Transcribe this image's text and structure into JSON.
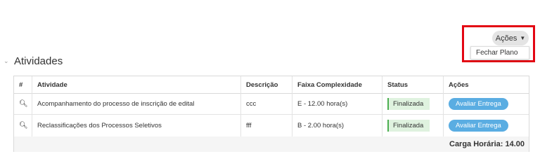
{
  "toolbar": {
    "acoes_label": "Ações",
    "dropdown_item": "Fechar Plano"
  },
  "section": {
    "title": "Atividades"
  },
  "table": {
    "headers": [
      "#",
      "Atividade",
      "Descrição",
      "Faixa Complexidade",
      "Status",
      "Ações"
    ],
    "rows": [
      {
        "atividade": "Acompanhamento do processo de inscrição de edital",
        "descricao": "ccc",
        "faixa": "E - 12.00 hora(s)",
        "status": "Finalizada",
        "acao": "Avaliar Entrega"
      },
      {
        "atividade": "Reclassificações dos Processos Seletivos",
        "descricao": "fff",
        "faixa": "B - 2.00 hora(s)",
        "status": "Finalizada",
        "acao": "Avaliar Entrega"
      }
    ],
    "footer": "Carga Horária: 14.00"
  },
  "colors": {
    "highlight": "#e30613",
    "button": "#5aade2",
    "status_bg": "#dff2df",
    "status_border": "#4caf50"
  },
  "icons": {
    "search": "search-icon",
    "chevron": "chevron-down-icon",
    "collapse": "chevron-down-icon"
  }
}
